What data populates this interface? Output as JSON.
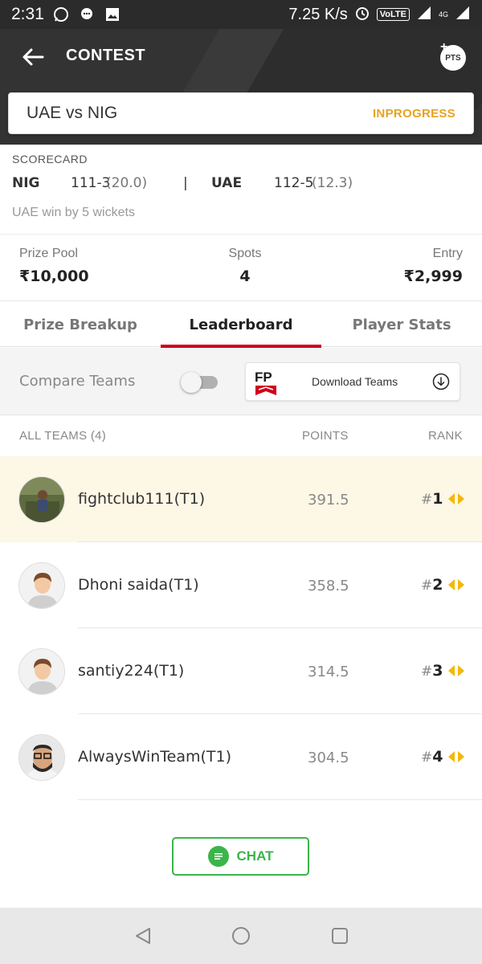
{
  "status_bar": {
    "time": "2:31",
    "speed": "7.25 K/s",
    "volte": "VoLTE",
    "network": "4G"
  },
  "header": {
    "title": "CONTEST",
    "pts_label": "PTS"
  },
  "match": {
    "name": "UAE vs NIG",
    "status": "INPROGRESS"
  },
  "scorecard": {
    "label": "SCORECARD",
    "team1": {
      "name": "NIG",
      "runs": "111-3",
      "overs": "(20.0)"
    },
    "separator": "|",
    "team2": {
      "name": "UAE",
      "runs": "112-5",
      "overs": "(12.3)"
    },
    "result": "UAE win by 5 wickets"
  },
  "contest_info": {
    "prize_pool": {
      "label": "Prize Pool",
      "value": "₹10,000"
    },
    "spots": {
      "label": "Spots",
      "value": "4"
    },
    "entry": {
      "label": "Entry",
      "value": "₹2,999"
    }
  },
  "tabs": [
    {
      "label": "Prize Breakup",
      "active": false
    },
    {
      "label": "Leaderboard",
      "active": true
    },
    {
      "label": "Player Stats",
      "active": false
    }
  ],
  "compare": {
    "label": "Compare Teams",
    "enabled": false,
    "download_label": "Download Teams",
    "logo_text": "FP"
  },
  "leaderboard": {
    "headers": {
      "teams": "ALL TEAMS (4)",
      "points": "POINTS",
      "rank": "RANK"
    },
    "rows": [
      {
        "name": "fightclub111(T1)",
        "points": "391.5",
        "hash": "#",
        "rank": "1",
        "highlight": true
      },
      {
        "name": "Dhoni saida(T1)",
        "points": "358.5",
        "hash": "#",
        "rank": "2",
        "highlight": false
      },
      {
        "name": "santiy224(T1)",
        "points": "314.5",
        "hash": "#",
        "rank": "3",
        "highlight": false
      },
      {
        "name": "AlwaysWinTeam(T1)",
        "points": "304.5",
        "hash": "#",
        "rank": "4",
        "highlight": false
      }
    ]
  },
  "chat": {
    "label": "CHAT"
  },
  "colors": {
    "accent_red": "#d0021b",
    "status_orange": "#e8a21f",
    "chat_green": "#3bb54a",
    "highlight_row": "#fdf7e6"
  },
  "icons": [
    "back-arrow-icon",
    "pts-add-icon",
    "download-icon",
    "rank-arrow-icon",
    "chat-icon",
    "nav-back-icon",
    "nav-home-icon",
    "nav-recents-icon"
  ]
}
